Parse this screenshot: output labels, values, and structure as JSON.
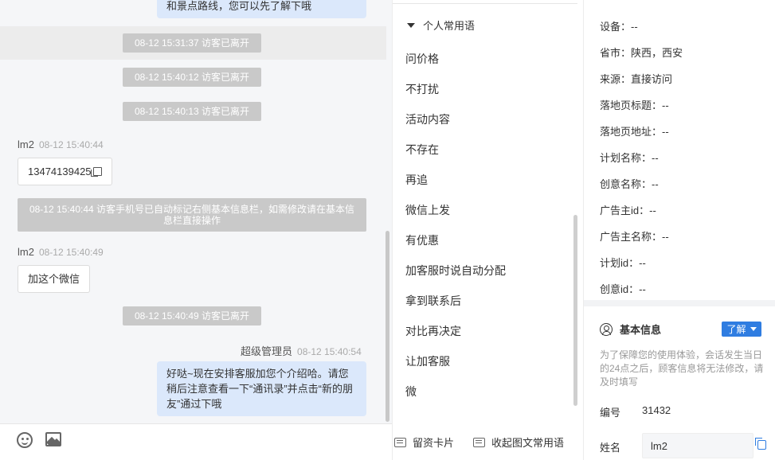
{
  "chat": {
    "top_bubble": "和景点路线，您可以先了解下哦",
    "system_left_1": "08-12 15:31:37 访客已离开",
    "system_left_2": "08-12 15:40:12 访客已离开",
    "system_left_3": "08-12 15:40:13 访客已离开",
    "msg1_sender": "lm2",
    "msg1_time": "08-12 15:40:44",
    "msg1_text": "13474139425",
    "system_phone": "08-12 15:40:44 访客手机号已自动标记右侧基本信息栏，如需修改请在基本信息栏直接操作",
    "msg2_sender": "lm2",
    "msg2_time": "08-12 15:40:49",
    "msg2_text": "加这个微信",
    "system_left_4": "08-12 15:40:49 访客已离开",
    "msg3_sender": "超级管理员",
    "msg3_time": "08-12 15:40:54",
    "msg3_text": "好哒~现在安排客服加您个介绍哈。请您稍后注意查看一下“通讯录”并点击“新的朋友”通过下哦"
  },
  "toolbar": {
    "emoji_icon": "emoji-icon",
    "image_icon": "image-icon"
  },
  "phrases": {
    "group_title": "个人常用语",
    "items": [
      "问价格",
      "不打扰",
      "活动内容",
      "不存在",
      "再追",
      "微信上发",
      "有优惠",
      "加客服时说自动分配",
      "拿到联系后",
      "对比再决定",
      "让加客服",
      "微"
    ],
    "card_label": "留资卡片",
    "collect_label": "收起图文常用语"
  },
  "info": {
    "rows": [
      {
        "label": "设备：",
        "value": "--"
      },
      {
        "label": "省市：",
        "value": "陕西，西安"
      },
      {
        "label": "来源：",
        "value": "直接访问"
      },
      {
        "label": "落地页标题：",
        "value": "--"
      },
      {
        "label": "落地页地址：",
        "value": "--"
      },
      {
        "label": "计划名称：",
        "value": "--"
      },
      {
        "label": "创意名称：",
        "value": "--"
      },
      {
        "label": "广告主id：",
        "value": "--"
      },
      {
        "label": "广告主名称：",
        "value": "--"
      },
      {
        "label": "计划id：",
        "value": "--"
      },
      {
        "label": "创意id：",
        "value": "--"
      }
    ],
    "section_title": "基本信息",
    "learn_label": "了解",
    "notice": "为了保障您的使用体验，会话发生当日的24点之后，顾客信息将无法修改，请及时填写",
    "id_label": "编号",
    "id_value": "31432",
    "name_label": "姓名",
    "name_value": "lm2"
  },
  "colors": {
    "accent": "#2f7de1",
    "bubble_right": "#dbe8fb",
    "system_bg": "#c9c9c9"
  }
}
